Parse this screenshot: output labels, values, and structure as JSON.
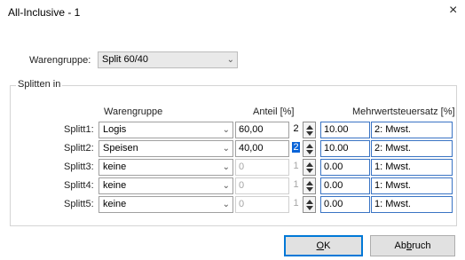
{
  "window": {
    "title": "All-Inclusive - 1",
    "close_glyph": "×"
  },
  "warengruppe": {
    "label": "Warengruppe:",
    "value": "Split 60/40"
  },
  "split_group": {
    "legend": "Splitten in",
    "headers": {
      "warengruppe": "Warengruppe",
      "anteil": "Anteil [%]",
      "mwst": "Mehrwertsteuersatz [%]"
    },
    "rows": [
      {
        "label": "Splitt1:",
        "gruppe": "Logis",
        "anteil": "60,00",
        "spin": "2",
        "rate": "10.00",
        "vat": "2: Mwst.",
        "enabled": true,
        "selected": false
      },
      {
        "label": "Splitt2:",
        "gruppe": "Speisen",
        "anteil": "40,00",
        "spin": "2",
        "rate": "10.00",
        "vat": "2: Mwst.",
        "enabled": true,
        "selected": true
      },
      {
        "label": "Splitt3:",
        "gruppe": "keine",
        "anteil": "0",
        "spin": "1",
        "rate": "0.00",
        "vat": "1: Mwst.",
        "enabled": false,
        "selected": false
      },
      {
        "label": "Splitt4:",
        "gruppe": "keine",
        "anteil": "0",
        "spin": "1",
        "rate": "0.00",
        "vat": "1: Mwst.",
        "enabled": false,
        "selected": false
      },
      {
        "label": "Splitt5:",
        "gruppe": "keine",
        "anteil": "0",
        "spin": "1",
        "rate": "0.00",
        "vat": "1: Mwst.",
        "enabled": false,
        "selected": false
      }
    ]
  },
  "buttons": {
    "ok": {
      "pre": "",
      "accel": "O",
      "post": "K"
    },
    "cancel": {
      "pre": "Ab",
      "accel": "b",
      "post": "ruch"
    }
  },
  "colors": {
    "focus_border": "#0078d7",
    "vat_border": "#3a74c4",
    "selection": "#0a64d8"
  },
  "icons": {
    "close": "close-icon",
    "dropdown": "chevron-down-icon",
    "spinner": "spinner-arrows-icon"
  }
}
